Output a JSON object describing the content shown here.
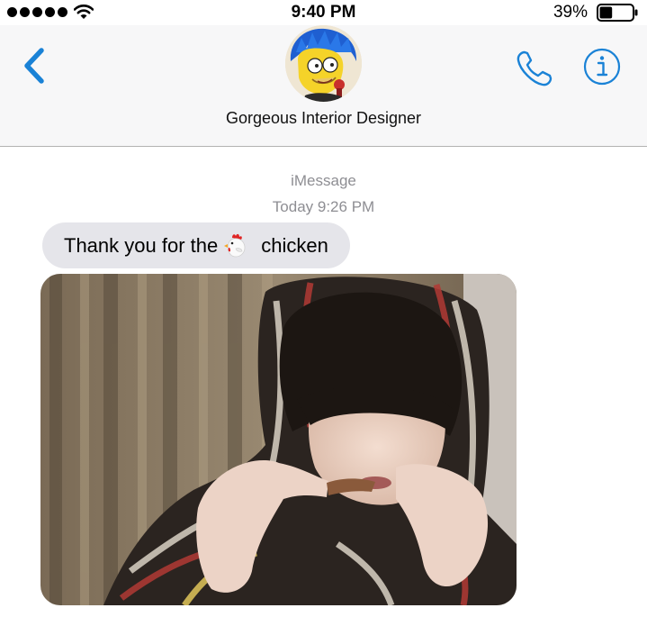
{
  "status_bar": {
    "time": "9:40 PM",
    "battery_percent": "39%",
    "battery_level": 0.39,
    "signal_bars": 5,
    "icons": [
      "signal-dots-icon",
      "wifi-icon",
      "battery-icon"
    ]
  },
  "header": {
    "contact_name": "Gorgeous Interior Designer",
    "icons": [
      "back-chevron-icon",
      "phone-icon",
      "info-icon"
    ],
    "accent_color": "#1a82d6"
  },
  "conversation": {
    "service": "iMessage",
    "timestamp": "Today 9:26 PM",
    "message": {
      "text_before": "Thank you for the",
      "emoji": "chicken-emoji-icon",
      "text_after": "chicken",
      "bubble_color": "#e5e5ea"
    },
    "attachment": {
      "type": "photo"
    }
  }
}
